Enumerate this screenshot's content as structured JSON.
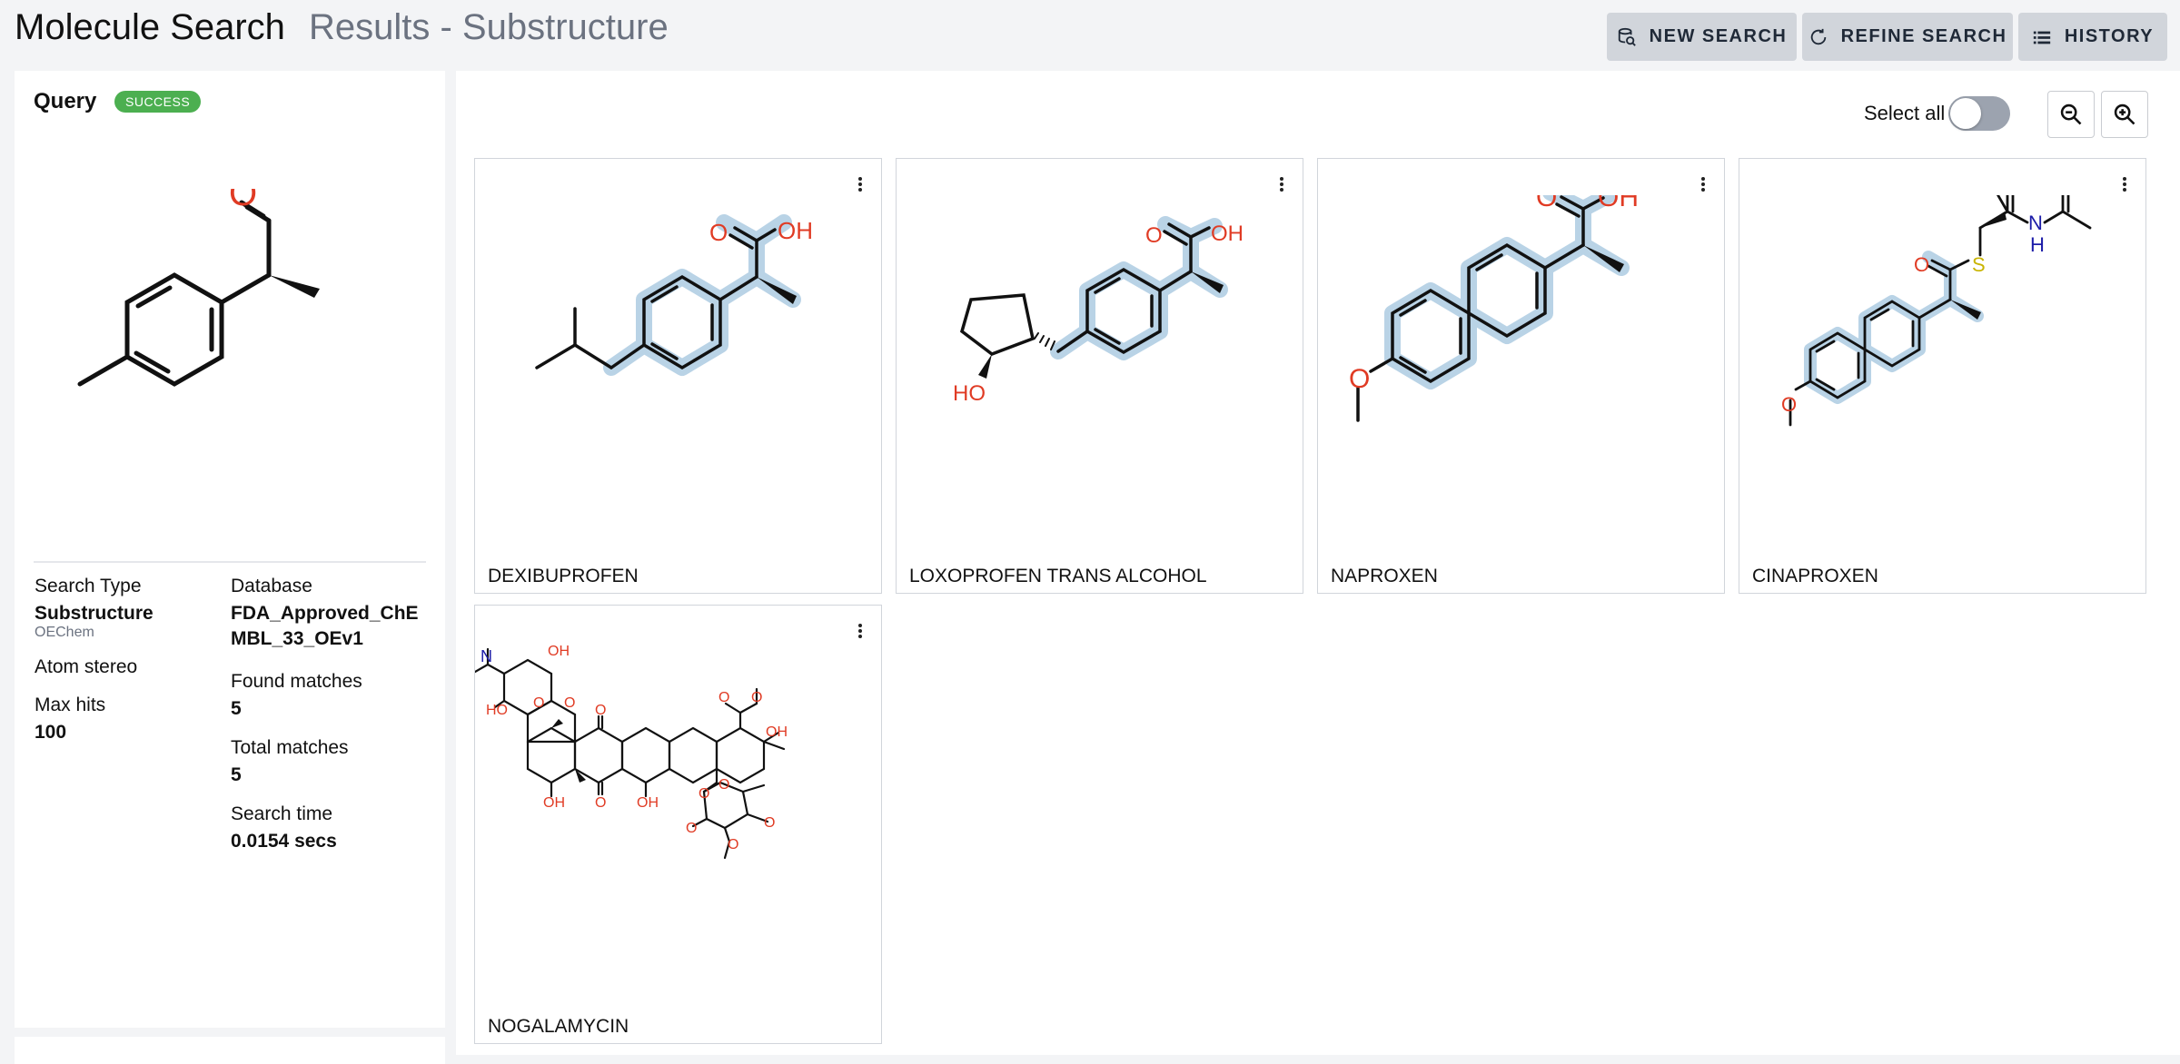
{
  "header": {
    "title": "Molecule Search",
    "subtitle": "Results - Substructure",
    "buttons": {
      "new_search": "NEW SEARCH",
      "refine_search": "REFINE SEARCH",
      "history": "HISTORY"
    }
  },
  "query": {
    "title": "Query",
    "status": "SUCCESS",
    "atoms": {
      "o": "O"
    }
  },
  "info": {
    "search_type_label": "Search Type",
    "search_type_value": "Substructure",
    "search_type_engine": "OEChem",
    "atom_stereo_label": "Atom stereo",
    "max_hits_label": "Max hits",
    "max_hits_value": "100",
    "database_label": "Database",
    "database_value_line1": "FDA_Approved_ChE",
    "database_value_line2": "MBL_33_OEv1",
    "found_matches_label": "Found matches",
    "found_matches_value": "5",
    "total_matches_label": "Total matches",
    "total_matches_value": "5",
    "search_time_label": "Search time",
    "search_time_value": "0.0154 secs"
  },
  "toolbar": {
    "select_all_label": "Select all",
    "select_all_on": false
  },
  "results": [
    {
      "name": "DEXIBUPROFEN"
    },
    {
      "name": "LOXOPROFEN TRANS ALCOHOL"
    },
    {
      "name": "NAPROXEN"
    },
    {
      "name": "CINAPROXEN"
    },
    {
      "name": "NOGALAMYCIN"
    }
  ],
  "atoms": {
    "o": "O",
    "oh": "OH",
    "ho": "HO",
    "s": "S",
    "n": "N",
    "h": "H"
  },
  "colors": {
    "success": "#4caf50",
    "oxygen": "#e03b24",
    "nitrogen": "#1c1ca8",
    "sulfur": "#c9b400",
    "highlight": "#b9d3e6",
    "button_bg": "#d1d5db"
  }
}
